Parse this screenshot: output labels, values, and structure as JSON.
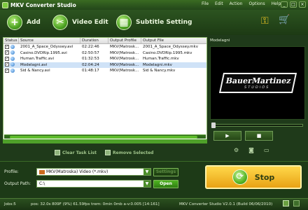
{
  "window": {
    "title": "MKV Converter Studio"
  },
  "menu": [
    "File",
    "Edit",
    "Action",
    "Options",
    "Help"
  ],
  "window_buttons": [
    "_",
    "□",
    "×"
  ],
  "toolbar": {
    "add": "Add",
    "video_edit": "Video Edit",
    "subtitle": "Subtitle Setting"
  },
  "table": {
    "headers": [
      "Status",
      "Source",
      "Duration",
      "Output Profile",
      "Output File"
    ],
    "rows": [
      {
        "source": "2001_A_Space_Odyssey.avi",
        "duration": "02:22:46",
        "profile": "MKV(Matrosk...",
        "file": "2001_A_Space_Odyssey.mkv"
      },
      {
        "source": "Casino.DVDRip.1995.avi",
        "duration": "02:50:57",
        "profile": "MKV(Matrosk...",
        "file": "Casino.DVDRip.1995.mkv"
      },
      {
        "source": "Human.Traffic.avi",
        "duration": "01:32:53",
        "profile": "MKV(Matrosk...",
        "file": "Human.Traffic.mkv"
      },
      {
        "source": "Modelagni.avi",
        "duration": "02:04:24",
        "profile": "MKV(Matrosk...",
        "file": "Modelagni.mkv"
      },
      {
        "source": "Sid & Nancy.avi",
        "duration": "01:48:17",
        "profile": "MKV(Matrosk...",
        "file": "Sid & Nancy.mkv"
      }
    ],
    "selected_row_index": 3
  },
  "task_actions": {
    "clear": "Clear Task List",
    "remove": "Remove Selected"
  },
  "preview": {
    "title": "Modelagni",
    "logo_main": "BauerMartinez",
    "logo_sub": "STUDIOS"
  },
  "player": {
    "play": "▶",
    "stop": "■"
  },
  "profile": {
    "label": "Profile:",
    "value": "MKV(Matroska) Video (*.mkv)",
    "settings": "Settings"
  },
  "output": {
    "label": "Output Path:",
    "value": "C:\\",
    "open": "Open"
  },
  "stop_button": {
    "label": "Stop"
  },
  "status": {
    "jobs": "Jobs:5",
    "progress": "pos: 32.0s 809F (9%) 61.59fps trem: 0min 0mb a-v:0.005 [14:161]",
    "version": "MKV Converter Studio V2.0.1 (Build 06/06/2010)"
  },
  "colors": {
    "accent": "#4fa12a",
    "stop": "#f3c02f",
    "background": "#1f3a1a"
  }
}
